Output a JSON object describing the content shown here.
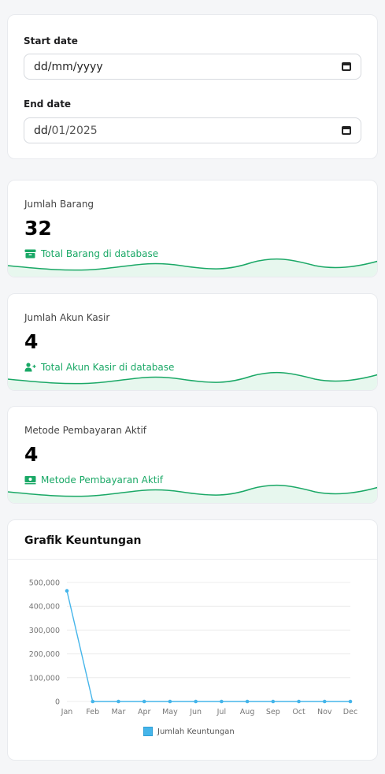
{
  "filters": {
    "start_date_label": "Start date",
    "start_date_value": "dd/mm/yyyy",
    "end_date_label": "End date",
    "end_date_value_prefix": "dd/",
    "end_date_value_rest": "01/2025"
  },
  "stats": [
    {
      "title": "Jumlah Barang",
      "value": "32",
      "subtitle": "Total Barang di database",
      "icon": "archive-box-icon",
      "color": "#1aa866"
    },
    {
      "title": "Jumlah Akun Kasir",
      "value": "4",
      "subtitle": "Total Akun Kasir di database",
      "icon": "user-plus-icon",
      "color": "#1aa866"
    },
    {
      "title": "Metode Pembayaran Aktif",
      "value": "4",
      "subtitle": "Metode Pembayaran Aktif",
      "icon": "money-icon",
      "color": "#1aa866"
    }
  ],
  "chart": {
    "title": "Grafik Keuntungan"
  },
  "chart_data": {
    "type": "line",
    "categories": [
      "Jan",
      "Feb",
      "Mar",
      "Apr",
      "May",
      "Jun",
      "Jul",
      "Aug",
      "Sep",
      "Oct",
      "Nov",
      "Dec"
    ],
    "series": [
      {
        "name": "Jumlah Keuntungan",
        "values": [
          465000,
          0,
          0,
          0,
          0,
          0,
          0,
          0,
          0,
          0,
          0,
          0
        ],
        "color": "#45b5ea"
      }
    ],
    "yticks": [
      "0",
      "100,000",
      "200,000",
      "300,000",
      "400,000",
      "500,000"
    ],
    "ylim": [
      0,
      500000
    ],
    "grid": true,
    "legend": "bottom"
  }
}
